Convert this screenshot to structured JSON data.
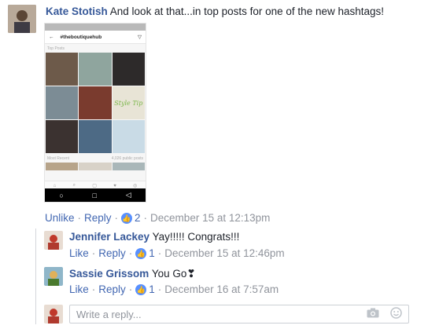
{
  "main_comment": {
    "author": "Kate Stotish",
    "text": "And look at that...in top posts for one of the new hashtags!",
    "actions": {
      "unlike": "Unlike",
      "reply": "Reply",
      "likes": "2",
      "timestamp": "December 15 at 12:13pm"
    }
  },
  "attachment": {
    "hashtag": "#theboutiquehub",
    "top_posts_label": "Top Posts",
    "most_recent_label": "Most Recent",
    "post_count": "4,026 public posts",
    "stylo_tip_text": "Style Tip",
    "grid_colors": [
      "#6d5a4a",
      "#8fa59e",
      "#2d2a2a",
      "#7c8c95",
      "#7a3b2e",
      "#e8e4d6",
      "#3b3230",
      "#4d6a85",
      "#c9dbe6"
    ]
  },
  "replies": [
    {
      "author": "Jennifer Lackey",
      "text": "Yay!!!!! Congrats!!!",
      "like": "Like",
      "reply": "Reply",
      "likes": "1",
      "timestamp": "December 15 at 12:46pm"
    },
    {
      "author": "Sassie Grissom",
      "text": "You Go❣",
      "like": "Like",
      "reply": "Reply",
      "likes": "1",
      "timestamp": "December 16 at 7:57am"
    }
  ],
  "reply_box": {
    "placeholder": "Write a reply..."
  },
  "colors": {
    "link": "#4267b2",
    "name": "#365899",
    "meta": "#90949c",
    "like_badge": "#5890ff"
  }
}
